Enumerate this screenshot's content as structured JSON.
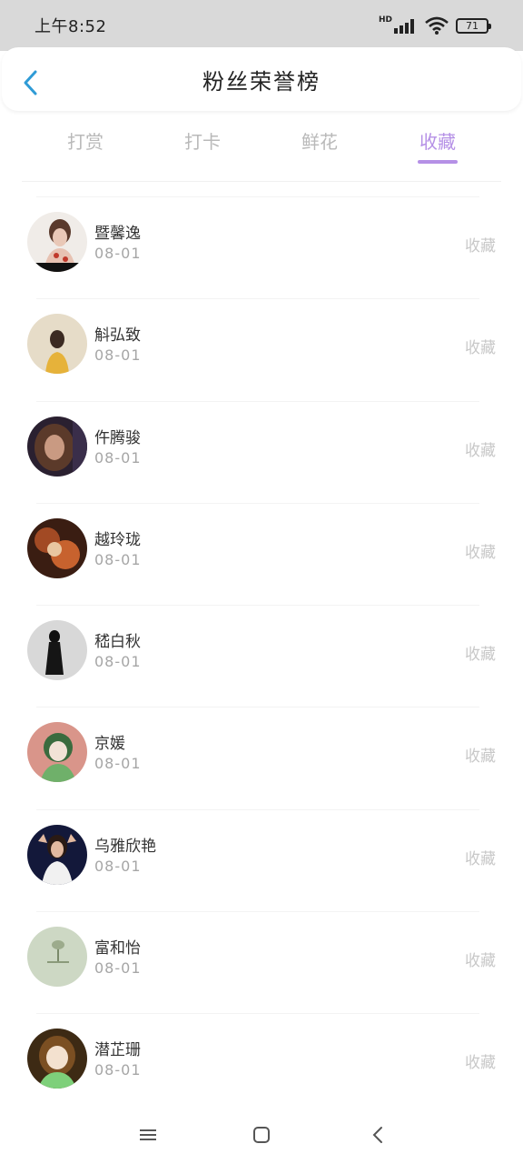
{
  "status": {
    "time": "上午8:52",
    "battery": "71",
    "hd": "HD"
  },
  "header": {
    "title": "粉丝荣誉榜"
  },
  "tabs": [
    {
      "label": "打赏"
    },
    {
      "label": "打卡"
    },
    {
      "label": "鲜花"
    },
    {
      "label": "收藏"
    }
  ],
  "active_tab": "收藏",
  "fans": [
    {
      "name": "暨馨逸",
      "date": "08-01",
      "action": "收藏"
    },
    {
      "name": "斛弘致",
      "date": "08-01",
      "action": "收藏"
    },
    {
      "name": "仵腾骏",
      "date": "08-01",
      "action": "收藏"
    },
    {
      "name": "越玲珑",
      "date": "08-01",
      "action": "收藏"
    },
    {
      "name": "嵇白秋",
      "date": "08-01",
      "action": "收藏"
    },
    {
      "name": "京媛",
      "date": "08-01",
      "action": "收藏"
    },
    {
      "name": "乌雅欣艳",
      "date": "08-01",
      "action": "收藏"
    },
    {
      "name": "富和怡",
      "date": "08-01",
      "action": "收藏"
    },
    {
      "name": "潜芷珊",
      "date": "08-01",
      "action": "收藏"
    }
  ],
  "colors": {
    "accent": "#b590e6",
    "statusbar": "#d9d9d9",
    "back_arrow": "#2f9bd6"
  }
}
